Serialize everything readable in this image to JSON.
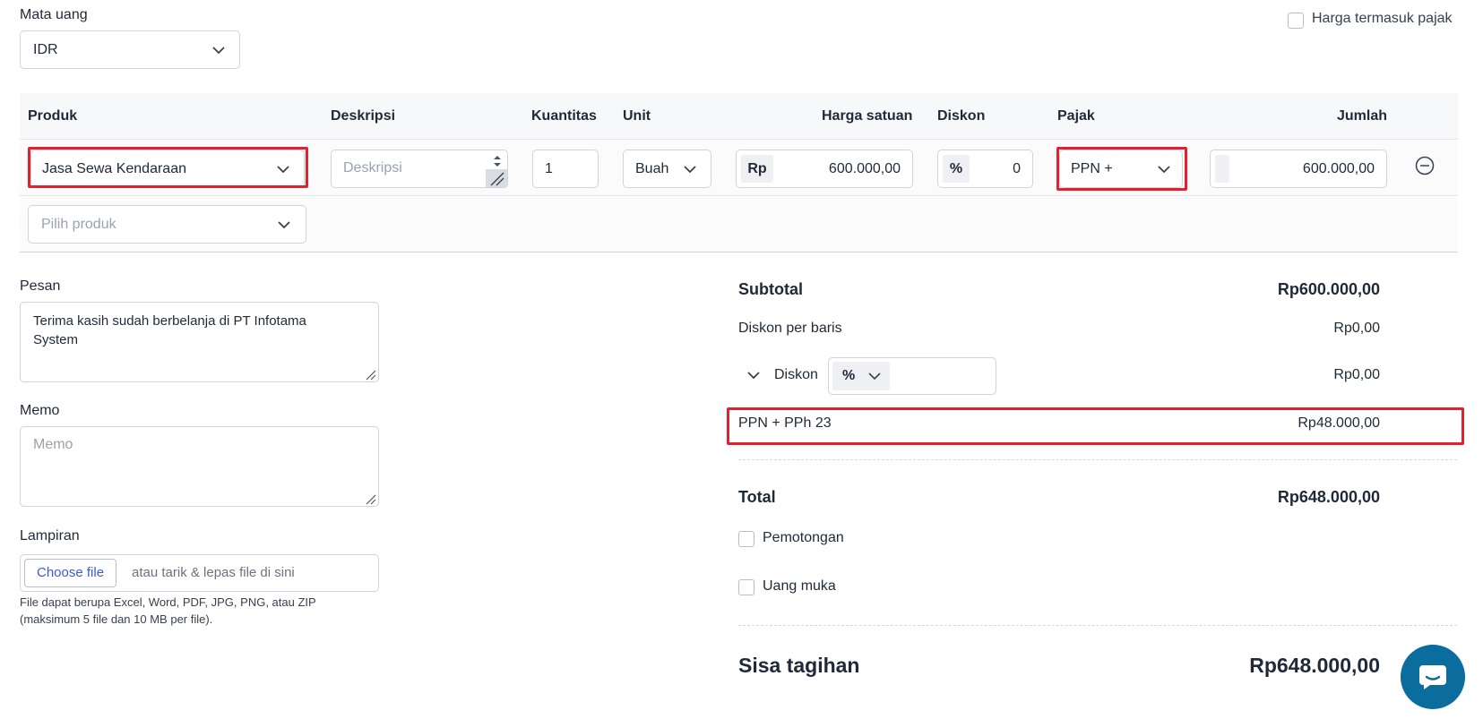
{
  "currency": {
    "label": "Mata uang",
    "value": "IDR"
  },
  "tax_inclusive": {
    "label": "Harga termasuk pajak",
    "checked": false
  },
  "table": {
    "headers": {
      "product": "Produk",
      "description": "Deskripsi",
      "quantity": "Kuantitas",
      "unit": "Unit",
      "unit_price": "Harga satuan",
      "discount": "Diskon",
      "tax": "Pajak",
      "amount": "Jumlah"
    },
    "rows": [
      {
        "product": "Jasa Sewa Kendaraan",
        "description_placeholder": "Deskripsi",
        "quantity": "1",
        "unit": "Buah",
        "price_prefix": "Rp",
        "unit_price": "600.000,00",
        "discount_prefix": "%",
        "discount": "0",
        "tax": "PPN +",
        "amount": "600.000,00"
      }
    ],
    "add_product_placeholder": "Pilih produk"
  },
  "message": {
    "label": "Pesan",
    "value": "Terima kasih sudah berbelanja di PT Infotama System"
  },
  "memo": {
    "label": "Memo",
    "placeholder": "Memo"
  },
  "attachment": {
    "label": "Lampiran",
    "button": "Choose file",
    "drop_text": "atau tarik & lepas file di sini",
    "help_line1": "File dapat berupa Excel, Word, PDF, JPG, PNG, atau ZIP",
    "help_line2": "(maksimum 5 file dan 10 MB per file)."
  },
  "summary": {
    "subtotal_label": "Subtotal",
    "subtotal_value": "Rp600.000,00",
    "line_discount_label": "Diskon per baris",
    "line_discount_value": "Rp0,00",
    "discount_label": "Diskon",
    "discount_type": "%",
    "discount_value": "Rp0,00",
    "tax_label": "PPN + PPh 23",
    "tax_value": "Rp48.000,00",
    "total_label": "Total",
    "total_value": "Rp648.000,00",
    "deduction_label": "Pemotongan",
    "down_payment_label": "Uang muka",
    "balance_label": "Sisa tagihan",
    "balance_value": "Rp648.000,00"
  },
  "colors": {
    "highlight": "#e4202e",
    "chat_button": "#0b6c9e",
    "link_blue": "#3b5bdb"
  }
}
